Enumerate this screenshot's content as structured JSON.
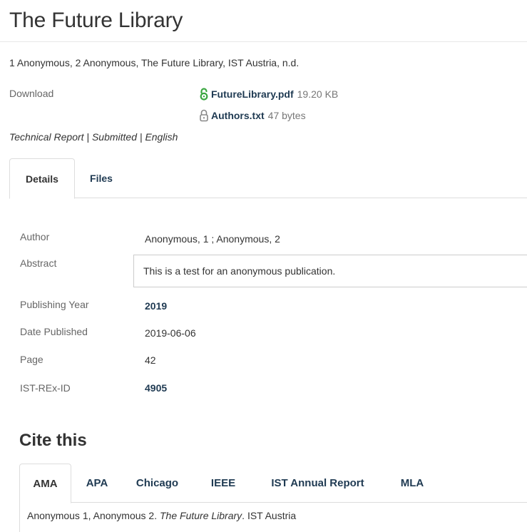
{
  "page": {
    "title": "The Future Library",
    "citation_line": "1 Anonymous, 2 Anonymous, The Future Library, IST Austria, n.d."
  },
  "download": {
    "label": "Download",
    "files": [
      {
        "name": "FutureLibrary.pdf",
        "size": "19.20 KB",
        "icon": "open-access-icon",
        "icon_color": "#3aa640"
      },
      {
        "name": "Authors.txt",
        "size": "47 bytes",
        "icon": "lock-icon",
        "icon_color": "#888888"
      }
    ]
  },
  "meta": {
    "type": "Technical Report",
    "status": "Submitted",
    "language": "English",
    "separator": " | "
  },
  "tabs": [
    {
      "label": "Details",
      "active": true
    },
    {
      "label": "Files",
      "active": false
    }
  ],
  "details": {
    "author": {
      "label": "Author",
      "value": "Anonymous, 1 ; Anonymous, 2"
    },
    "abstract": {
      "label": "Abstract",
      "value": "This is a test for an anonymous publication."
    },
    "publishing_year": {
      "label": "Publishing Year",
      "value": "2019"
    },
    "date_published": {
      "label": "Date Published",
      "value": "2019-06-06"
    },
    "page": {
      "label": "Page",
      "value": "42"
    },
    "ist_rex_id": {
      "label": "IST-REx-ID",
      "value": "4905"
    }
  },
  "cite": {
    "heading": "Cite this",
    "tabs": [
      "AMA",
      "APA",
      "Chicago",
      "IEEE",
      "IST Annual Report",
      "MLA"
    ],
    "active_tab": "AMA",
    "text_prefix": "Anonymous 1, Anonymous 2. ",
    "text_title": "The Future Library",
    "text_suffix": ". IST Austria"
  },
  "colors": {
    "link": "#1f3a52",
    "open_access": "#3aa640",
    "muted_label": "#666666",
    "border": "#dddddd"
  }
}
